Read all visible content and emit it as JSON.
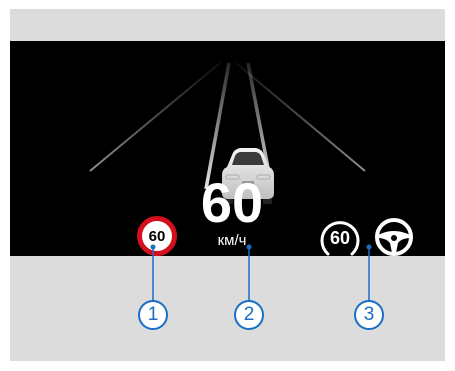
{
  "display": {
    "speed_value": "60",
    "speed_unit": "км/ч",
    "speed_limit_sign": "60",
    "cruise_set_speed": "60",
    "icons": {
      "vehicle": "car-rear-icon",
      "steering": "steering-wheel-icon"
    }
  },
  "callouts": [
    {
      "label": "1"
    },
    {
      "label": "2"
    },
    {
      "label": "3"
    }
  ],
  "colors": {
    "screen_bg": "#000000",
    "panel_bg": "#dcdcdc",
    "sign_border": "#d4101d",
    "callout": "#1a6fc4"
  }
}
